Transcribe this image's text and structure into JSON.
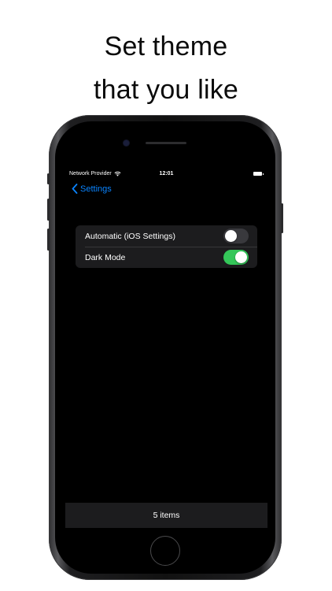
{
  "headline": {
    "line1": "Set theme",
    "line2": "that you like"
  },
  "status_bar": {
    "carrier": "Network Provider",
    "time": "12:01"
  },
  "nav": {
    "back_label": "Settings"
  },
  "settings": {
    "rows": [
      {
        "label": "Automatic (iOS Settings)",
        "enabled": false
      },
      {
        "label": "Dark Mode",
        "enabled": true
      }
    ]
  },
  "footer": {
    "count_label": "5 items"
  },
  "colors": {
    "accent": "#0a84ff",
    "switch_on": "#34c759",
    "switch_off": "#39393d",
    "cell_bg": "#1c1c1e",
    "screen_bg": "#000000"
  },
  "icons": {
    "back": "chevron-left-icon",
    "wifi": "wifi-icon",
    "battery": "battery-icon"
  }
}
